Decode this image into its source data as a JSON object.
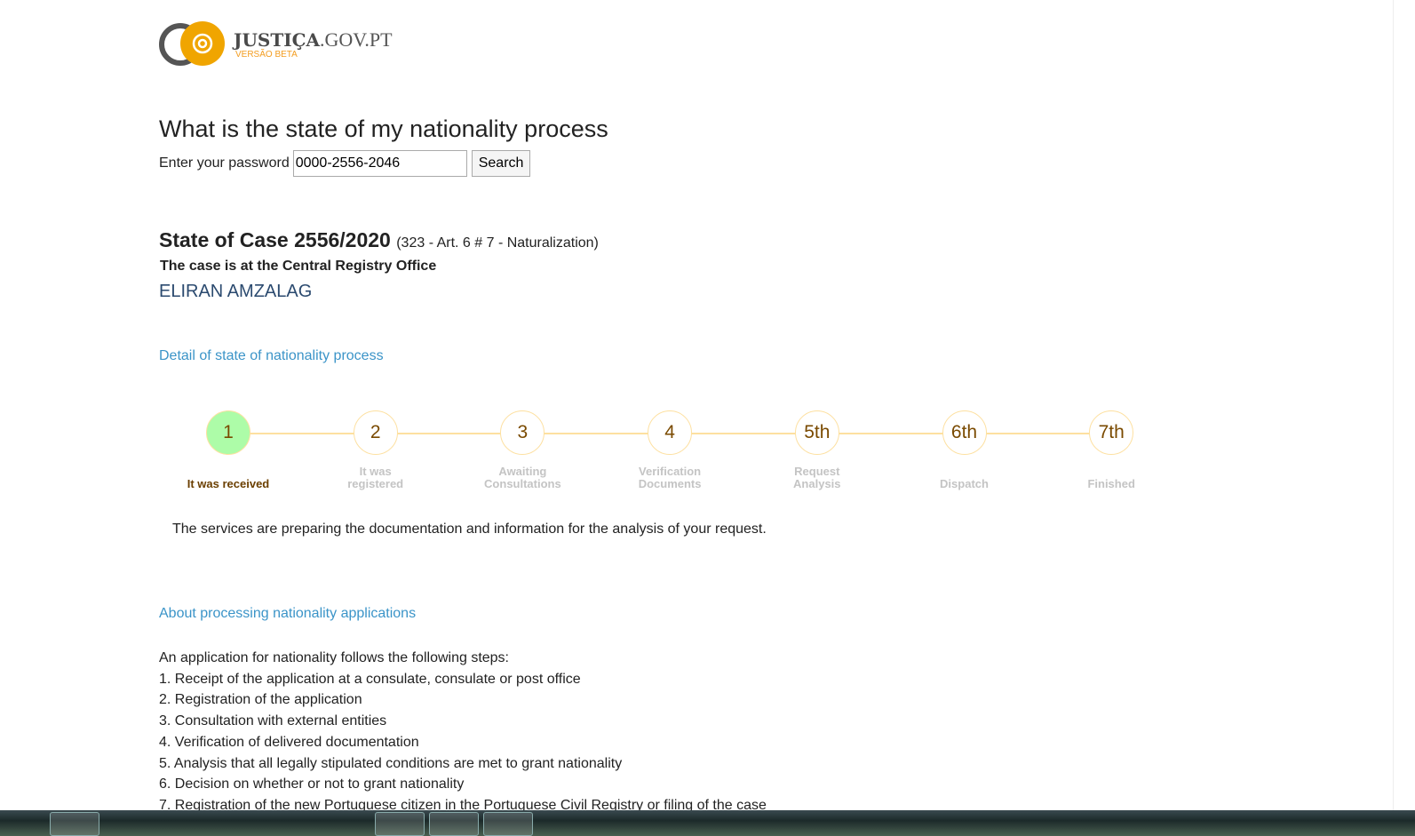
{
  "logo": {
    "brand_bold": "JUSTIÇA",
    "brand_domain": ".GOV.PT",
    "tagline": "VERSÃO BETA"
  },
  "title": "What is the state of my nationality process",
  "form": {
    "label": "Enter your password",
    "value": "0000-2556-2046",
    "button": "Search"
  },
  "case": {
    "title": "State of Case 2556/2020",
    "detail": "(323 - Art. 6 # 7 - Naturalization)",
    "location": "The case is at the Central Registry Office",
    "applicant": "ELIRAN AMZALAG"
  },
  "detail_link": "Detail of state of nationality process",
  "steps": [
    {
      "num": "1",
      "label": "It was received",
      "active": true
    },
    {
      "num": "2",
      "label": "It was registered",
      "active": false
    },
    {
      "num": "3",
      "label": "Awaiting Consultations",
      "active": false
    },
    {
      "num": "4",
      "label": "Verification Documents",
      "active": false
    },
    {
      "num": "5th",
      "label": "Request Analysis",
      "active": false
    },
    {
      "num": "6th",
      "label": "Dispatch",
      "active": false
    },
    {
      "num": "7th",
      "label": "Finished",
      "active": false
    }
  ],
  "step_description": "The services are preparing the documentation and information for the analysis of your request.",
  "about_link": "About processing nationality applications",
  "about": {
    "intro": "An application for nationality follows the following steps:",
    "items": [
      "1. Receipt of the application at a consulate, consulate or post office",
      "2. Registration of the application",
      "3. Consultation with external entities",
      "4. Verification of delivered documentation",
      "5. Analysis that all legally stipulated conditions are met to grant nationality",
      "6. Decision on whether or not to grant nationality",
      "7. Registration of the new Portuguese citizen in the Portuguese Civil Registry or filing of the case"
    ]
  },
  "colors": {
    "active_step": "#adfca8",
    "step_border": "#fde0a0",
    "link": "#3b94c8",
    "logo_orange": "#f0a500"
  }
}
